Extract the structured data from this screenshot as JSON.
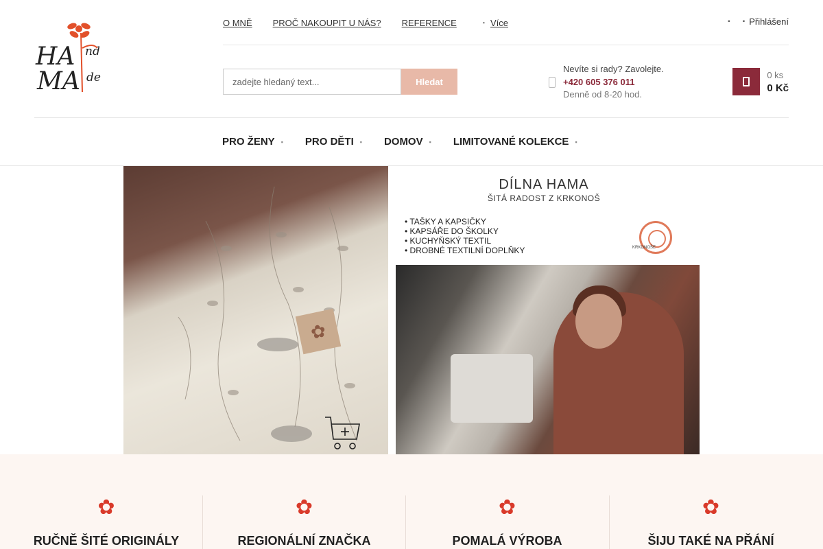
{
  "logo": {
    "text_1": "HA",
    "text_2": "nd",
    "text_3": "MA",
    "text_4": "de",
    "flower_icon": "flower-icon"
  },
  "topnav": {
    "items": [
      "O MNĚ",
      "PROČ NAKOUPIT U NÁS?",
      "REFERENCE"
    ],
    "more": "Více"
  },
  "header": {
    "login": "Přihlášení"
  },
  "search": {
    "placeholder": "zadejte hledaný text...",
    "button": "Hledat"
  },
  "contact": {
    "question": "Nevíte si rady? Zavolejte.",
    "phone": "+420 605 376 011",
    "hours": "Denně od 8-20 hod."
  },
  "cart": {
    "count": "0 ks",
    "price": "0 Kč"
  },
  "menu": {
    "items": [
      "PRO ŽENY",
      "PRO DĚTI",
      "DOMOV",
      "LIMITOVANÉ KOLEKCE"
    ]
  },
  "banner": {
    "title": "DÍLNA HAMA",
    "subtitle": "ŠITÁ RADOST Z KRKONOŠ",
    "list": [
      "TAŠKY A KAPSIČKY",
      "KAPSÁŘE DO ŠKOLKY",
      "KUCHYŇSKÝ TEXTIL",
      "DROBNÉ TEXTILNÍ DOPLŇKY"
    ],
    "badge": "KRKONOŠE"
  },
  "features": [
    "RUČNĚ ŠITÉ ORIGINÁLY",
    "REGIONÁLNÍ ZNAČKA",
    "POMALÁ VÝROBA",
    "ŠIJU TAKÉ NA PŘÁNÍ"
  ],
  "colors": {
    "accent": "#8b2a3a",
    "search_button": "#e8b9a8",
    "flower": "#d93a2a",
    "strip_bg": "#fdf6f2"
  }
}
